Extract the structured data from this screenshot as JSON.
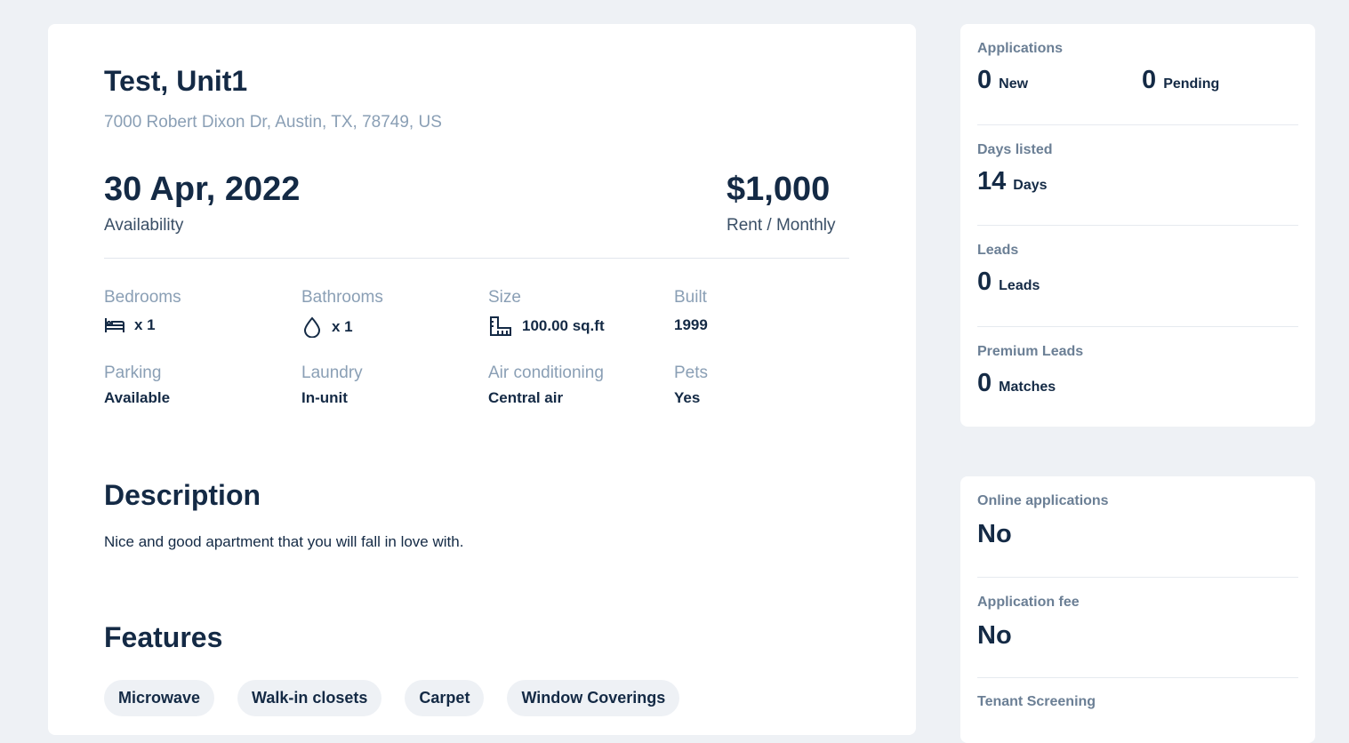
{
  "listing": {
    "title": "Test, Unit1",
    "address": "7000 Robert Dixon Dr, Austin, TX, 78749, US",
    "availability_date": "30 Apr, 2022",
    "availability_label": "Availability",
    "rent": "$1,000",
    "rent_label": "Rent / Monthly"
  },
  "specs": {
    "bedrooms": {
      "label": "Bedrooms",
      "value": "x 1",
      "icon": "bed-icon"
    },
    "bathrooms": {
      "label": "Bathrooms",
      "value": "x 1",
      "icon": "water-drop-icon"
    },
    "size": {
      "label": "Size",
      "value": "100.00 sq.ft",
      "icon": "ruler-icon"
    },
    "built": {
      "label": "Built",
      "value": "1999"
    },
    "parking": {
      "label": "Parking",
      "value": "Available"
    },
    "laundry": {
      "label": "Laundry",
      "value": "In-unit"
    },
    "air_conditioning": {
      "label": "Air conditioning",
      "value": "Central air"
    },
    "pets": {
      "label": "Pets",
      "value": "Yes"
    }
  },
  "description": {
    "title": "Description",
    "text": "Nice and good apartment that you will fall in love with."
  },
  "features": {
    "title": "Features",
    "items": [
      "Microwave",
      "Walk-in closets",
      "Carpet",
      "Window Coverings"
    ]
  },
  "stats": {
    "applications": {
      "label": "Applications",
      "new_count": "0",
      "new_label": "New",
      "pending_count": "0",
      "pending_label": "Pending"
    },
    "days_listed": {
      "label": "Days listed",
      "count": "14",
      "unit": "Days"
    },
    "leads": {
      "label": "Leads",
      "count": "0",
      "unit": "Leads"
    },
    "premium_leads": {
      "label": "Premium Leads",
      "count": "0",
      "unit": "Matches"
    }
  },
  "settings": {
    "online_applications": {
      "label": "Online applications",
      "value": "No"
    },
    "application_fee": {
      "label": "Application fee",
      "value": "No"
    },
    "tenant_screening": {
      "label": "Tenant Screening"
    }
  },
  "colors": {
    "background": "#eef1f5",
    "card": "#ffffff",
    "text_primary": "#142a45",
    "text_muted": "#8a9fb5"
  }
}
